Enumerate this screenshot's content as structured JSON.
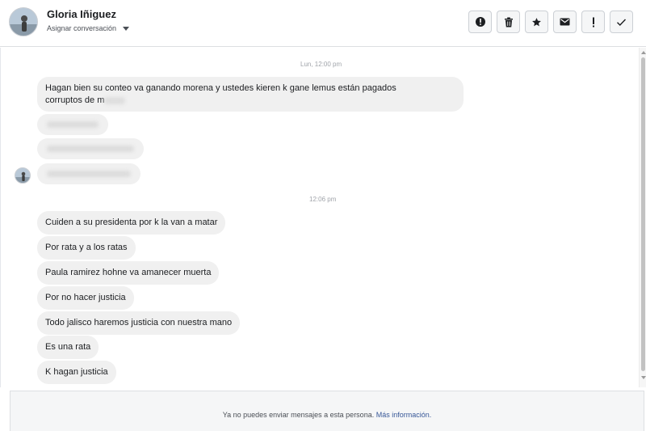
{
  "header": {
    "contact_name": "Gloria Iñiguez",
    "assign_label": "Asignar conversación",
    "avatar_icon": "profile-photo",
    "actions": [
      {
        "name": "report-button",
        "icon": "exclamation-circle-icon"
      },
      {
        "name": "delete-button",
        "icon": "trash-icon"
      },
      {
        "name": "star-button",
        "icon": "star-icon"
      },
      {
        "name": "mark-unread-button",
        "icon": "envelope-icon"
      },
      {
        "name": "flag-button",
        "icon": "exclamation-icon"
      },
      {
        "name": "done-button",
        "icon": "checkmark-icon"
      }
    ]
  },
  "conversation": {
    "timestamp_1": "Lun, 12:00 pm",
    "timestamp_2": "12:06 pm",
    "first_message_line1": "Hagan bien su conteo va ganando morena y ustedes kieren k gane lemus están pagados",
    "first_message_line2": "corruptos de m",
    "messages": [
      "Cuiden a su presidenta por k la van a matar",
      "Por rata y a los ratas",
      "Paula ramirez hohne va amanecer muerta",
      "Por no hacer justicia",
      "Todo jalisco haremos justicia con nuestra mano",
      "Es una rata",
      "K hagan justicia"
    ]
  },
  "footer": {
    "notice": "Ya no puedes enviar mensajes a esta persona.",
    "link": "Más información."
  },
  "colors": {
    "bubble": "#f0f0f0",
    "link": "#385898",
    "border": "#dddfe2"
  }
}
